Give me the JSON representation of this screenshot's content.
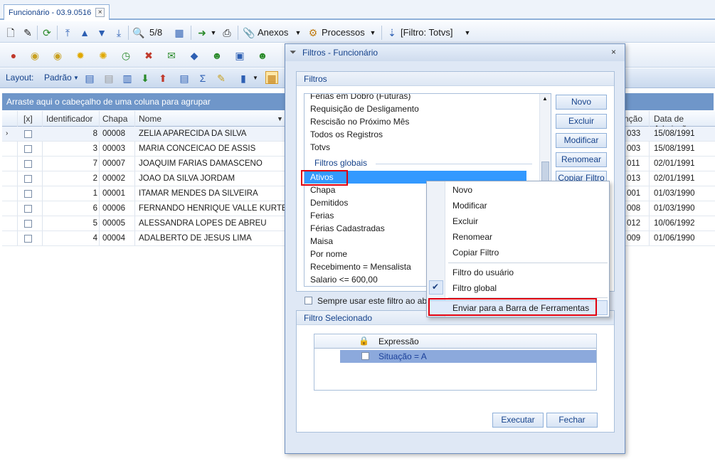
{
  "tab": {
    "title": "Funcionário - 03.9.0516",
    "close": "×"
  },
  "toolbar1": {
    "record_counter": "5/8",
    "attachments_label": "Anexos",
    "processes_label": "Processos",
    "filter_label": "[Filtro: Totvs]"
  },
  "layoutbar": {
    "layout_label": "Layout:",
    "layout_value": "Padrão"
  },
  "groupbar": {
    "text": "Arraste aqui o cabeçalho de uma coluna para agrupar"
  },
  "grid": {
    "headers": {
      "sel": "[x]",
      "id": "Identificador",
      "chapa": "Chapa",
      "nome": "Nome",
      "funcao": "nção",
      "admissao": "Data de Admissão"
    },
    "rows": [
      {
        "id": "8",
        "chapa": "00008",
        "nome": "ZELIA APARECIDA DA SILVA",
        "funcao": "033",
        "admissao": "15/08/1991"
      },
      {
        "id": "3",
        "chapa": "00003",
        "nome": "MARIA CONCEICAO DE ASSIS",
        "funcao": "003",
        "admissao": "15/08/1991"
      },
      {
        "id": "7",
        "chapa": "00007",
        "nome": "JOAQUIM FARIAS DAMASCENO",
        "funcao": "011",
        "admissao": "02/01/1991"
      },
      {
        "id": "2",
        "chapa": "00002",
        "nome": "JOAO DA SILVA JORDAM",
        "funcao": "013",
        "admissao": "02/01/1991"
      },
      {
        "id": "1",
        "chapa": "00001",
        "nome": "ITAMAR MENDES DA SILVEIRA",
        "funcao": "001",
        "admissao": "01/03/1990"
      },
      {
        "id": "6",
        "chapa": "00006",
        "nome": "FERNANDO HENRIQUE VALLE KURTEN",
        "funcao": "008",
        "admissao": "01/03/1990"
      },
      {
        "id": "5",
        "chapa": "00005",
        "nome": "ALESSANDRA LOPES DE ABREU",
        "funcao": "012",
        "admissao": "10/06/1992"
      },
      {
        "id": "4",
        "chapa": "00004",
        "nome": "ADALBERTO DE JESUS LIMA",
        "funcao": "009",
        "admissao": "01/06/1990"
      }
    ]
  },
  "dialog": {
    "title": "Filtros - Funcionário",
    "close": "×",
    "filters_group_title": "Filtros",
    "list_items_top": [
      "Férias em Dobro (Futuras)",
      "Requisição de Desligamento",
      "Rescisão no Próximo Mês",
      "Todos os Registros",
      "Totvs"
    ],
    "global_section_title": "Filtros globais",
    "list_items_global": [
      "Ativos",
      "Chapa",
      "Demitidos",
      "Ferias",
      "Férias Cadastradas",
      "Maisa",
      "Por nome",
      "Recebimento = Mensalista",
      "Salario <= 600,00"
    ],
    "buttons": {
      "novo": "Novo",
      "excluir": "Excluir",
      "modificar": "Modificar",
      "renomear": "Renomear",
      "copiar": "Copiar Filtro"
    },
    "always_use_label": "Sempre usar este filtro ao abrir a",
    "selected_group_title": "Filtro Selecionado",
    "expr_header": "Expressão",
    "expr_value": "Situação = A",
    "executar": "Executar",
    "fechar": "Fechar"
  },
  "context_menu": {
    "items": [
      "Novo",
      "Modificar",
      "Excluir",
      "Renomear",
      "Copiar Filtro"
    ],
    "filter_user": "Filtro do usuário",
    "filter_global": "Filtro global",
    "send_toolbar": "Enviar para a Barra de Ferramentas",
    "check": "✔"
  },
  "colors": {
    "accent": "#15428b",
    "highlight": "#3399ff",
    "annotation": "#e0000e"
  }
}
